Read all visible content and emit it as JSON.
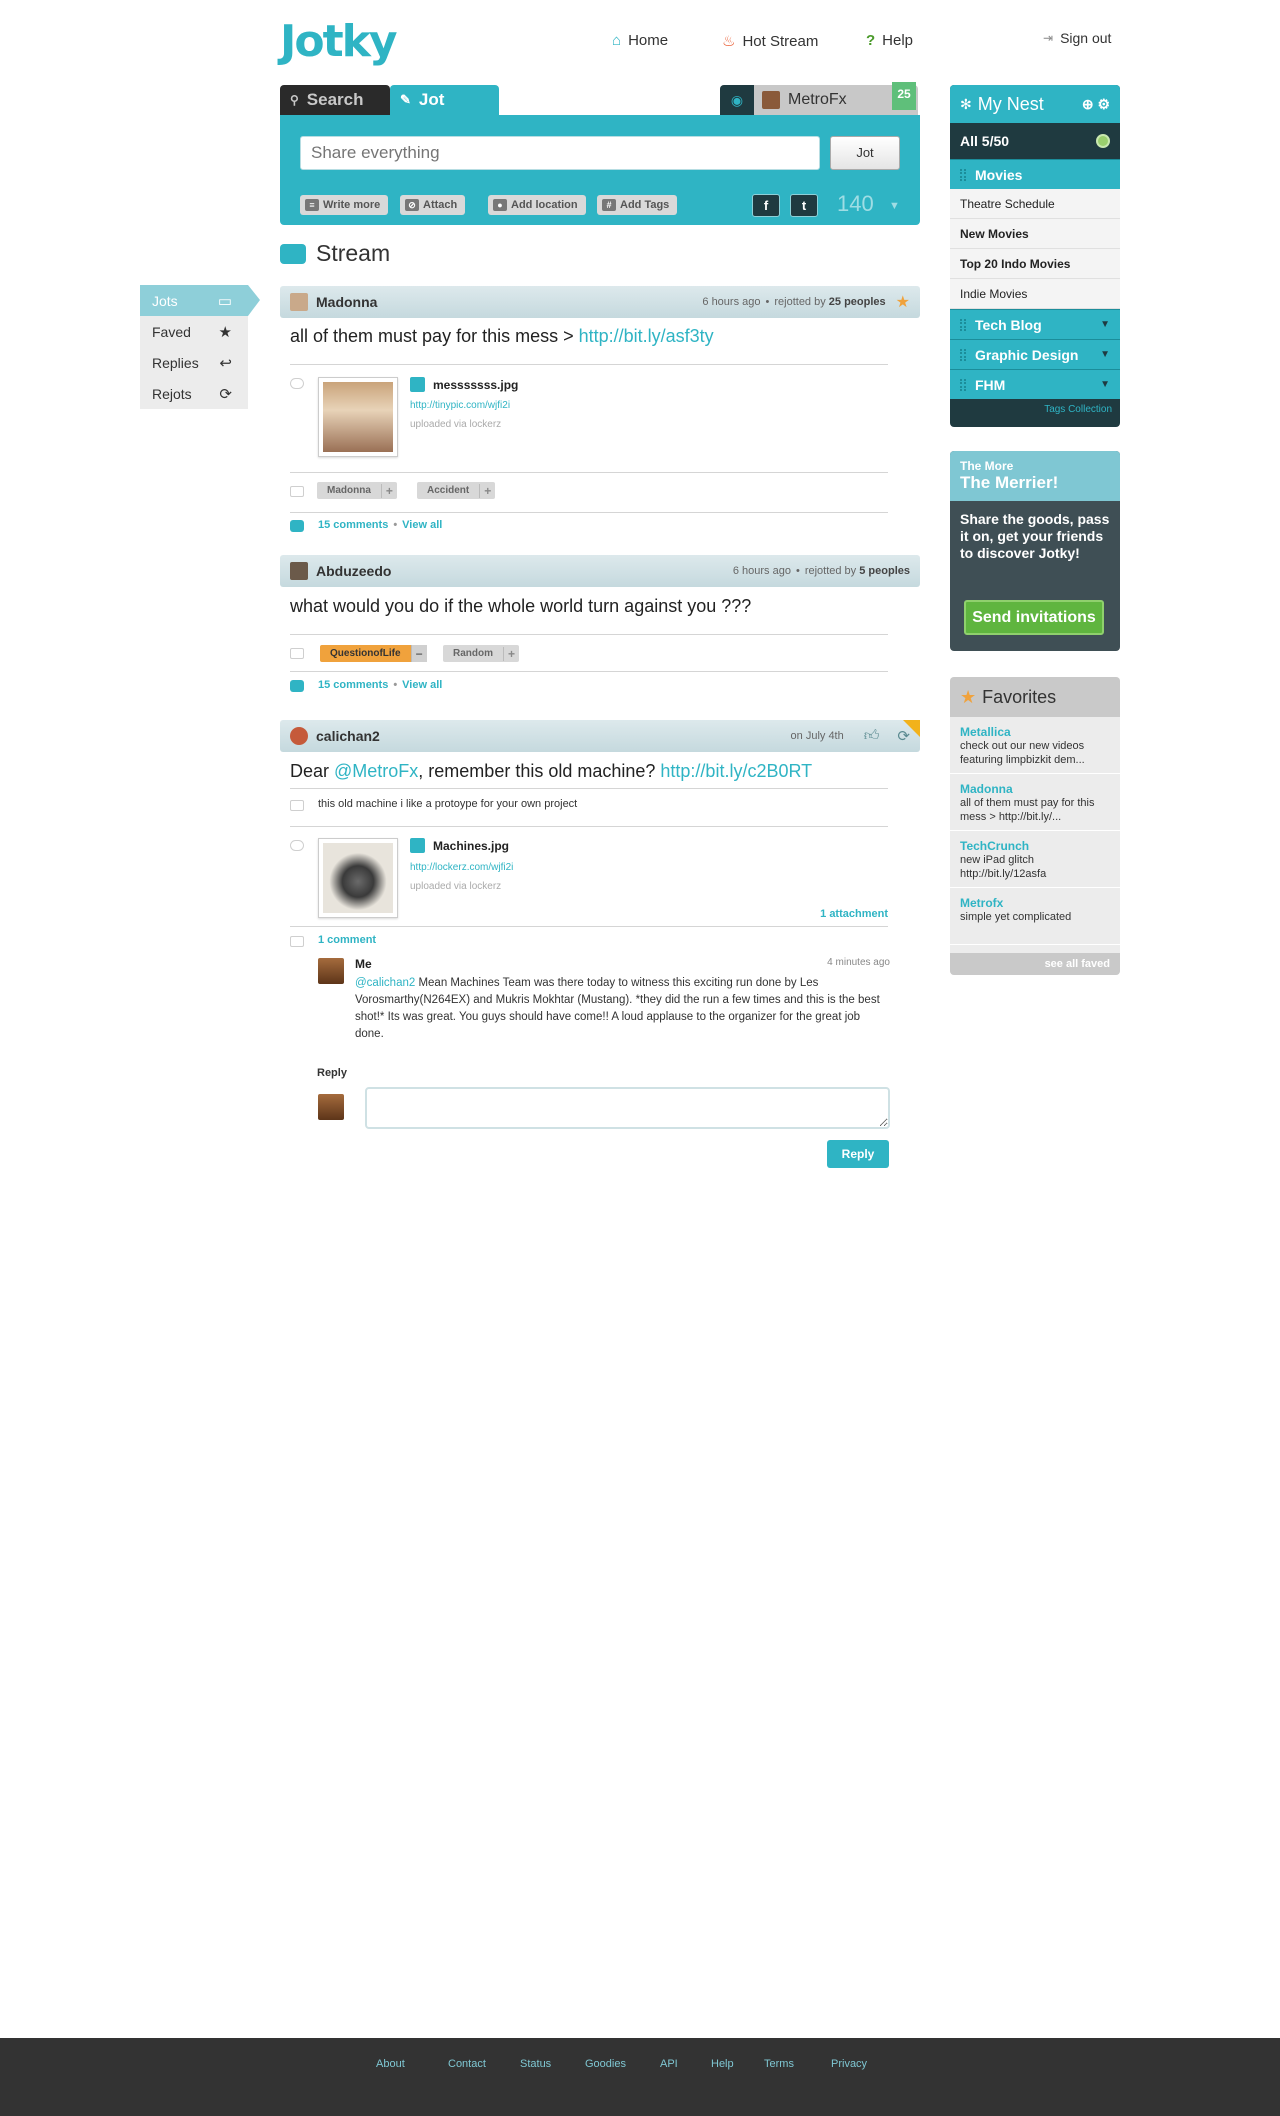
{
  "brand": {
    "logo": "Jotky",
    "accent": "#2fb4c4"
  },
  "nav": {
    "home": "Home",
    "hot_stream": "Hot Stream",
    "help": "Help",
    "sign_out": "Sign out"
  },
  "compose": {
    "tab_search": "Search",
    "tab_jot": "Jot",
    "user": "MetroFx",
    "badge": "25",
    "placeholder": "Share everything",
    "jot_button": "Jot",
    "tools": {
      "write_more": "Write more",
      "attach": "Attach",
      "add_location": "Add location",
      "add_tags": "Add Tags"
    },
    "share_fb": "f",
    "share_tw": "t",
    "count": "140"
  },
  "stream": {
    "title": "Stream"
  },
  "filters": [
    {
      "label": "Jots",
      "icon": "speech-icon"
    },
    {
      "label": "Faved",
      "icon": "star-icon"
    },
    {
      "label": "Replies",
      "icon": "reply-icon"
    },
    {
      "label": "Rejots",
      "icon": "rejot-icon"
    }
  ],
  "jots": [
    {
      "author": "Madonna",
      "time": "6 hours ago",
      "rejotted_prefix": "rejotted by",
      "rejotted": "25 peoples",
      "text": "all of them must pay for this mess > ",
      "link": "http://bit.ly/asf3ty",
      "attachment": {
        "name": "messsssss.jpg",
        "url": "http://tinypic.com/wjfi2i",
        "via": "uploaded via lockerz"
      },
      "tags": [
        "Madonna",
        "Accident"
      ],
      "comments": "15 comments",
      "view_all": "View all"
    },
    {
      "author": "Abduzeedo",
      "time": "6 hours ago",
      "rejotted_prefix": "rejotted by",
      "rejotted": "5 peoples",
      "text": "what would you do if the whole world turn against you ???",
      "tags": [
        "QuestionofLife",
        "Random"
      ],
      "comments": "15 comments",
      "view_all": "View all"
    },
    {
      "author": "calichan2",
      "time": "on July 4th",
      "text_a": "Dear ",
      "mention": "@MetroFx",
      "text_b": ", remember this old machine? ",
      "link": "http://bit.ly/c2B0RT",
      "subtext": "this old machine i like a protoype for your own project",
      "attachment": {
        "name": "Machines.jpg",
        "url": "http://lockerz.com/wjfi2i",
        "via": "uploaded via lockerz",
        "count": "1 attachment"
      },
      "comments": "1 comment",
      "comment": {
        "name": "Me",
        "time": "4 minutes ago",
        "mention": "@calichan2",
        "body": " Mean Machines Team was there today to witness this exciting run done by Les Vorosmarthy(N264EX) and Mukris Mokhtar (Mustang). *they did the run a few times and this is the best shot!* Its was great. You guys should have come!! A loud applause to the organizer for the great job done."
      },
      "reply_label": "Reply",
      "reply_button": "Reply"
    }
  ],
  "nest": {
    "title": "My Nest",
    "all": "All  5/50",
    "categories": [
      {
        "name": "Movies",
        "items": [
          "Theatre Schedule",
          "New Movies",
          "Top 20 Indo Movies",
          "Indie Movies"
        ]
      },
      {
        "name": "Tech Blog"
      },
      {
        "name": "Graphic Design"
      },
      {
        "name": "FHM"
      }
    ],
    "tags_collection": "Tags Collection"
  },
  "invite": {
    "small": "The More",
    "large": "The Merrier!",
    "body": "Share the goods, pass it on, get your friends to discover Jotky!",
    "button": "Send invitations"
  },
  "favorites": {
    "title": "Favorites",
    "items": [
      {
        "name": "Metallica",
        "text": "check out our new videos featuring limpbizkit dem..."
      },
      {
        "name": "Madonna",
        "text": "all of them must pay for this mess > http://bit.ly/..."
      },
      {
        "name": "TechCrunch",
        "text": "new iPad glitch http://bit.ly/12asfa"
      },
      {
        "name": "Metrofx",
        "text": "simple yet complicated"
      }
    ],
    "see_all": "see all faved"
  },
  "footer": [
    "About",
    "Contact",
    "Status",
    "Goodies",
    "API",
    "Help",
    "Terms",
    "Privacy"
  ]
}
